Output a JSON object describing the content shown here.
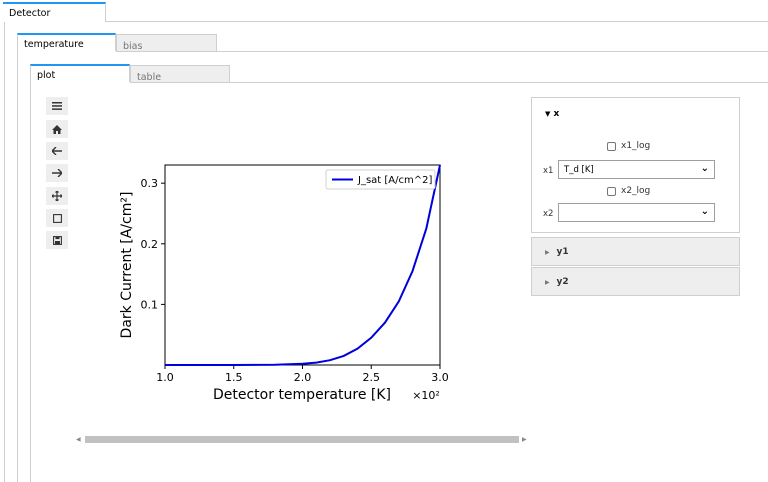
{
  "outer_tabs": [
    {
      "label": "Detector",
      "active": true
    }
  ],
  "mid_tabs": [
    {
      "label": "temperature",
      "active": true
    },
    {
      "label": "bias",
      "active": false
    }
  ],
  "inner_tabs": [
    {
      "label": "plot",
      "active": true
    },
    {
      "label": "table",
      "active": false
    }
  ],
  "toolbar": {
    "icons": [
      "menu-icon",
      "home-icon",
      "back-arrow-icon",
      "forward-arrow-icon",
      "pan-icon",
      "zoom-rect-icon",
      "save-icon"
    ]
  },
  "chart_data": {
    "type": "line",
    "xlabel": "Detector temperature [K]",
    "ylabel": "Dark Current [A/cm²]",
    "x_multiplier": "×10²",
    "xlim": [
      1.0,
      3.0
    ],
    "ylim": [
      0.0,
      0.33
    ],
    "x_ticks": [
      1.0,
      1.5,
      2.0,
      2.5,
      3.0
    ],
    "x_tick_labels": [
      "1.0",
      "1.5",
      "2.0",
      "2.5",
      "3.0"
    ],
    "y_ticks": [
      0.1,
      0.2,
      0.3
    ],
    "y_tick_labels": [
      "0.1",
      "0.2",
      "0.3"
    ],
    "grid": false,
    "legend": "top-right",
    "series": [
      {
        "name": "J_sat [A/cm^2]",
        "color": "#0000dd",
        "x": [
          1.0,
          1.5,
          1.8,
          2.0,
          2.1,
          2.2,
          2.3,
          2.4,
          2.5,
          2.6,
          2.7,
          2.8,
          2.9,
          3.0
        ],
        "y": [
          0.0,
          0.0,
          0.0005,
          0.002,
          0.004,
          0.008,
          0.015,
          0.027,
          0.045,
          0.07,
          0.105,
          0.155,
          0.225,
          0.33
        ]
      }
    ]
  },
  "panel": {
    "x_title": "x",
    "x1_log_label": "x1_log",
    "x1_label": "x1",
    "x1_value": "T_d [K]",
    "x2_log_label": "x2_log",
    "x2_label": "x2",
    "x2_value": "",
    "y1_title": "y1",
    "y2_title": "y2"
  }
}
